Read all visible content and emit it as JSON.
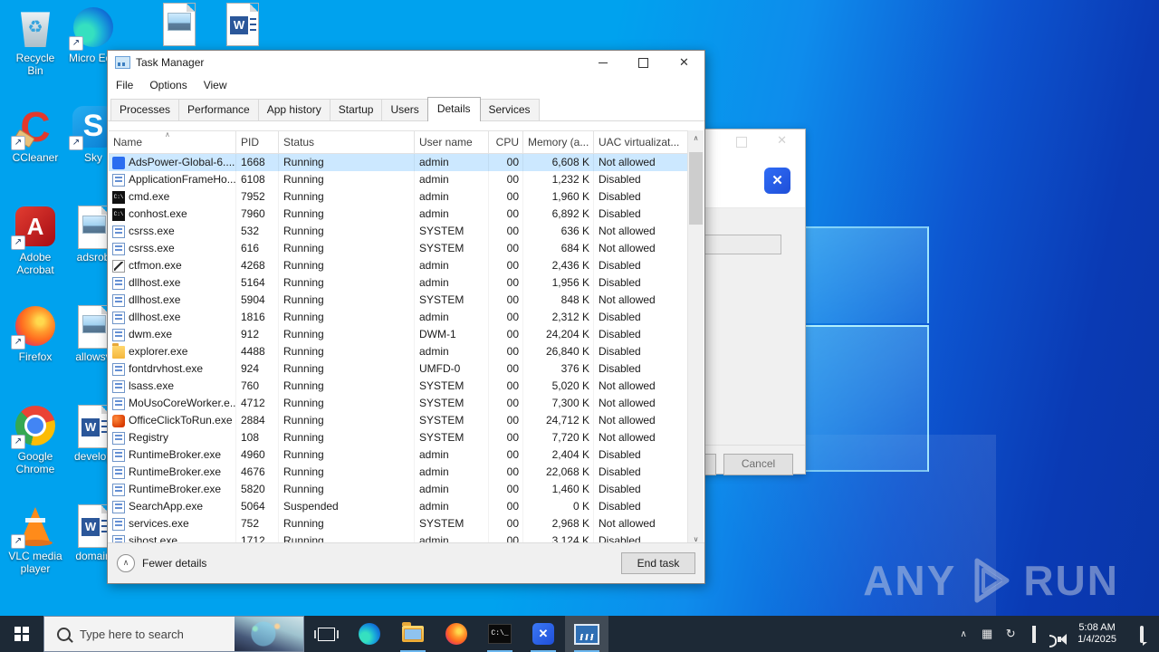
{
  "colors": {
    "accent": "#0078d7",
    "selection": "#cce8ff",
    "desktop_blue": "#00a2ee",
    "desktop_dark_blue": "#0936a9",
    "taskbar": "#1d2936"
  },
  "watermark": {
    "left": "ANY",
    "right": "RUN"
  },
  "desktop": {
    "column1": [
      {
        "id": "recycle-bin",
        "label": "Recycle Bin",
        "type": "recycle",
        "shortcut": false
      },
      {
        "id": "ccleaner",
        "label": "CCleaner",
        "type": "ccleaner",
        "shortcut": true
      },
      {
        "id": "adobe-acrobat",
        "label": "Adobe Acrobat",
        "type": "acrobat",
        "shortcut": true
      },
      {
        "id": "firefox",
        "label": "Firefox",
        "type": "firefox",
        "shortcut": true
      },
      {
        "id": "google-chrome",
        "label": "Google Chrome",
        "type": "chrome",
        "shortcut": true
      },
      {
        "id": "vlc-media-player",
        "label": "VLC media player",
        "type": "vlc",
        "shortcut": true
      }
    ],
    "column2": [
      {
        "id": "microsoft-edge",
        "label": "Micro Edg",
        "type": "edge",
        "shortcut": true
      },
      {
        "id": "skype",
        "label": "Sky",
        "type": "skype",
        "shortcut": true
      },
      {
        "id": "adsrob",
        "label": "adsrob",
        "type": "imagefile",
        "shortcut": false
      },
      {
        "id": "allowsv",
        "label": "allowsv",
        "type": "imagefile",
        "shortcut": false
      },
      {
        "id": "develop",
        "label": "develop",
        "type": "wordfile",
        "shortcut": false
      },
      {
        "id": "domain",
        "label": "domain",
        "type": "wordfile",
        "shortcut": false
      }
    ],
    "top_row": [
      {
        "id": "image-file",
        "type": "imagefile"
      },
      {
        "id": "word-document",
        "type": "wordfile"
      }
    ]
  },
  "dialog": {
    "logo": "adspower-logo",
    "cancel_label": "Cancel"
  },
  "task_manager": {
    "title": "Task Manager",
    "menu": [
      "File",
      "Options",
      "View"
    ],
    "tabs": [
      {
        "label": "Processes",
        "active": false
      },
      {
        "label": "Performance",
        "active": false
      },
      {
        "label": "App history",
        "active": false
      },
      {
        "label": "Startup",
        "active": false
      },
      {
        "label": "Users",
        "active": false
      },
      {
        "label": "Details",
        "active": true
      },
      {
        "label": "Services",
        "active": false
      }
    ],
    "columns": [
      "Name",
      "PID",
      "Status",
      "User name",
      "CPU",
      "Memory (a...",
      "UAC virtualizat..."
    ],
    "rows": [
      {
        "name": "AdsPower-Global-6....",
        "pid": "1668",
        "status": "Running",
        "user": "admin",
        "cpu": "00",
        "mem": "6,608 K",
        "uac": "Not allowed",
        "icon": "adspower",
        "selected": true
      },
      {
        "name": "ApplicationFrameHo...",
        "pid": "6108",
        "status": "Running",
        "user": "admin",
        "cpu": "00",
        "mem": "1,232 K",
        "uac": "Disabled",
        "icon": "window",
        "selected": false
      },
      {
        "name": "cmd.exe",
        "pid": "7952",
        "status": "Running",
        "user": "admin",
        "cpu": "00",
        "mem": "1,960 K",
        "uac": "Disabled",
        "icon": "console",
        "selected": false
      },
      {
        "name": "conhost.exe",
        "pid": "7960",
        "status": "Running",
        "user": "admin",
        "cpu": "00",
        "mem": "6,892 K",
        "uac": "Disabled",
        "icon": "console",
        "selected": false
      },
      {
        "name": "csrss.exe",
        "pid": "532",
        "status": "Running",
        "user": "SYSTEM",
        "cpu": "00",
        "mem": "636 K",
        "uac": "Not allowed",
        "icon": "window",
        "selected": false
      },
      {
        "name": "csrss.exe",
        "pid": "616",
        "status": "Running",
        "user": "SYSTEM",
        "cpu": "00",
        "mem": "684 K",
        "uac": "Not allowed",
        "icon": "window",
        "selected": false
      },
      {
        "name": "ctfmon.exe",
        "pid": "4268",
        "status": "Running",
        "user": "admin",
        "cpu": "00",
        "mem": "2,436 K",
        "uac": "Disabled",
        "icon": "ctf",
        "selected": false
      },
      {
        "name": "dllhost.exe",
        "pid": "5164",
        "status": "Running",
        "user": "admin",
        "cpu": "00",
        "mem": "1,956 K",
        "uac": "Disabled",
        "icon": "window",
        "selected": false
      },
      {
        "name": "dllhost.exe",
        "pid": "5904",
        "status": "Running",
        "user": "SYSTEM",
        "cpu": "00",
        "mem": "848 K",
        "uac": "Not allowed",
        "icon": "window",
        "selected": false
      },
      {
        "name": "dllhost.exe",
        "pid": "1816",
        "status": "Running",
        "user": "admin",
        "cpu": "00",
        "mem": "2,312 K",
        "uac": "Disabled",
        "icon": "window",
        "selected": false
      },
      {
        "name": "dwm.exe",
        "pid": "912",
        "status": "Running",
        "user": "DWM-1",
        "cpu": "00",
        "mem": "24,204 K",
        "uac": "Disabled",
        "icon": "window",
        "selected": false
      },
      {
        "name": "explorer.exe",
        "pid": "4488",
        "status": "Running",
        "user": "admin",
        "cpu": "00",
        "mem": "26,840 K",
        "uac": "Disabled",
        "icon": "folder",
        "selected": false
      },
      {
        "name": "fontdrvhost.exe",
        "pid": "924",
        "status": "Running",
        "user": "UMFD-0",
        "cpu": "00",
        "mem": "376 K",
        "uac": "Disabled",
        "icon": "window",
        "selected": false
      },
      {
        "name": "lsass.exe",
        "pid": "760",
        "status": "Running",
        "user": "SYSTEM",
        "cpu": "00",
        "mem": "5,020 K",
        "uac": "Not allowed",
        "icon": "window",
        "selected": false
      },
      {
        "name": "MoUsoCoreWorker.e...",
        "pid": "4712",
        "status": "Running",
        "user": "SYSTEM",
        "cpu": "00",
        "mem": "7,300 K",
        "uac": "Not allowed",
        "icon": "window",
        "selected": false
      },
      {
        "name": "OfficeClickToRun.exe",
        "pid": "2884",
        "status": "Running",
        "user": "SYSTEM",
        "cpu": "00",
        "mem": "24,712 K",
        "uac": "Not allowed",
        "icon": "office",
        "selected": false
      },
      {
        "name": "Registry",
        "pid": "108",
        "status": "Running",
        "user": "SYSTEM",
        "cpu": "00",
        "mem": "7,720 K",
        "uac": "Not allowed",
        "icon": "window",
        "selected": false
      },
      {
        "name": "RuntimeBroker.exe",
        "pid": "4960",
        "status": "Running",
        "user": "admin",
        "cpu": "00",
        "mem": "2,404 K",
        "uac": "Disabled",
        "icon": "window",
        "selected": false
      },
      {
        "name": "RuntimeBroker.exe",
        "pid": "4676",
        "status": "Running",
        "user": "admin",
        "cpu": "00",
        "mem": "22,068 K",
        "uac": "Disabled",
        "icon": "window",
        "selected": false
      },
      {
        "name": "RuntimeBroker.exe",
        "pid": "5820",
        "status": "Running",
        "user": "admin",
        "cpu": "00",
        "mem": "1,460 K",
        "uac": "Disabled",
        "icon": "window",
        "selected": false
      },
      {
        "name": "SearchApp.exe",
        "pid": "5064",
        "status": "Suspended",
        "user": "admin",
        "cpu": "00",
        "mem": "0 K",
        "uac": "Disabled",
        "icon": "window",
        "selected": false
      },
      {
        "name": "services.exe",
        "pid": "752",
        "status": "Running",
        "user": "SYSTEM",
        "cpu": "00",
        "mem": "2,968 K",
        "uac": "Not allowed",
        "icon": "window",
        "selected": false
      },
      {
        "name": "sihost.exe",
        "pid": "1712",
        "status": "Running",
        "user": "admin",
        "cpu": "00",
        "mem": "3,124 K",
        "uac": "Disabled",
        "icon": "window",
        "selected": false
      }
    ],
    "footer": {
      "toggle": "Fewer details",
      "end_task": "End task"
    }
  },
  "taskbar": {
    "search_placeholder": "Type here to search",
    "apps": [
      {
        "id": "edge",
        "running": false,
        "active": false
      },
      {
        "id": "file-explorer",
        "running": true,
        "active": false
      },
      {
        "id": "firefox",
        "running": false,
        "active": false
      },
      {
        "id": "cmd",
        "running": true,
        "active": false
      },
      {
        "id": "adspower",
        "running": true,
        "active": false
      },
      {
        "id": "task-manager",
        "running": true,
        "active": true
      }
    ],
    "clock": {
      "time": "5:08 AM",
      "date": "1/4/2025"
    }
  }
}
